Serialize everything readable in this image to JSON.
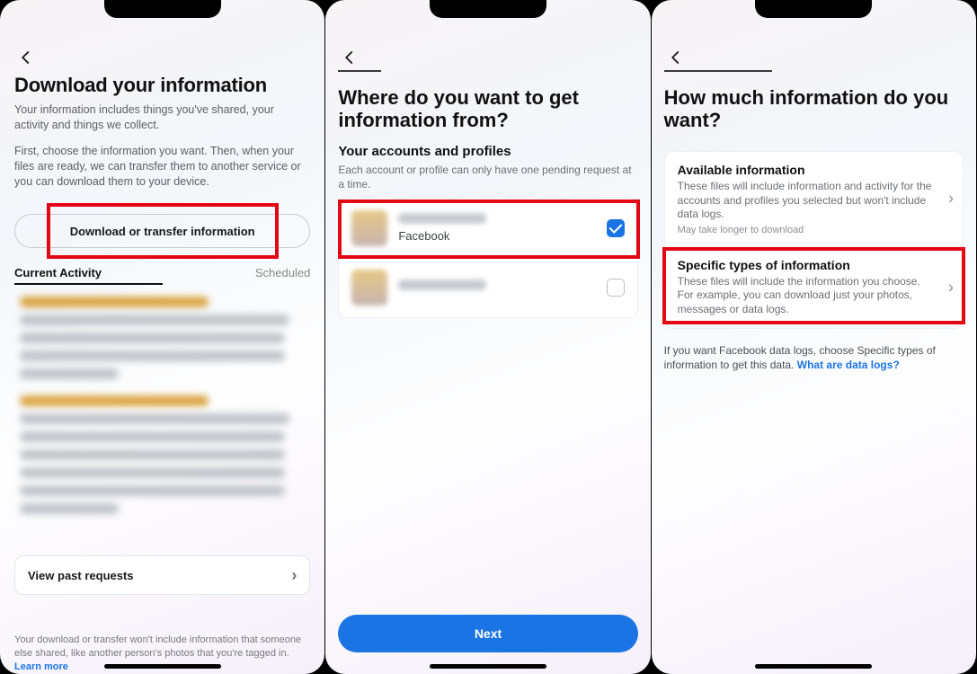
{
  "panel1": {
    "title": "Download your information",
    "sub1": "Your information includes things you've shared, your activity and things we collect.",
    "sub2": "First, choose the information you want. Then, when your files are ready, we can transfer them to another service or you can download them to your device.",
    "download_button": "Download or transfer information",
    "tabs": {
      "current": "Current Activity",
      "scheduled": "Scheduled"
    },
    "view_past": "View past requests",
    "footer_text": "Your download or transfer won't include information that someone else shared, like another person's photos that you're tagged in. ",
    "footer_link": "Learn more"
  },
  "panel2": {
    "title": "Where do you want to get information from?",
    "subtitle": "Your accounts and profiles",
    "desc": "Each account or profile can only have one pending request at a time.",
    "accounts": [
      {
        "platform": "Facebook",
        "checked": true
      },
      {
        "platform": "",
        "checked": false
      }
    ],
    "next": "Next"
  },
  "panel3": {
    "title": "How much information do you want?",
    "opt1_title": "Available information",
    "opt1_desc": "These files will include information and activity for the accounts and profiles you selected but won't include data logs.",
    "opt1_note": "May take longer to download",
    "opt2_title": "Specific types of information",
    "opt2_desc": "These files will include the information you choose. For example, you can download just your photos, messages or data logs.",
    "note_text": "If you want Facebook data logs, choose Specific types of information to get this data. ",
    "note_link": "What are data logs?"
  }
}
